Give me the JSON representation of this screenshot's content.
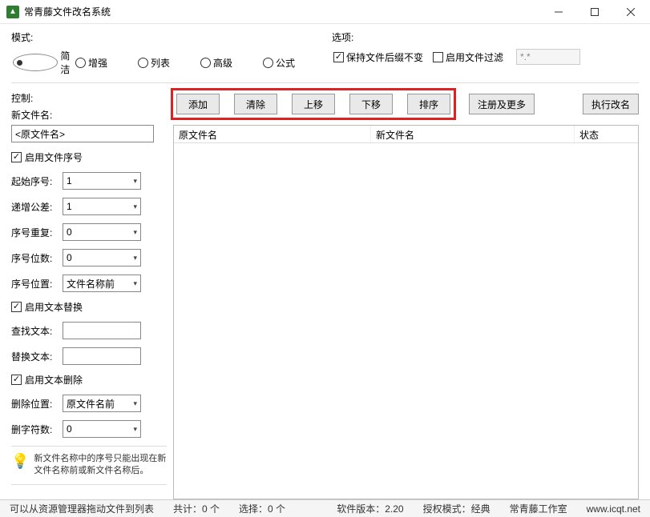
{
  "window": {
    "title": "常青藤文件改名系统",
    "icon_glyph": "▲"
  },
  "mode": {
    "label": "模式:",
    "options": [
      "简洁",
      "增强",
      "列表",
      "高级",
      "公式"
    ],
    "selected": "简洁"
  },
  "options": {
    "label": "选项:",
    "keep_ext": {
      "label": "保持文件后缀不变",
      "checked": true
    },
    "enable_filter": {
      "label": "启用文件过滤",
      "checked": false
    },
    "filter_value": "*.*"
  },
  "control": {
    "label": "控制:",
    "new_name": {
      "label": "新文件名:",
      "value": "<原文件名>"
    },
    "enable_seq": {
      "label": "启用文件序号",
      "checked": true
    },
    "start_no": {
      "label": "起始序号:",
      "value": "1"
    },
    "step": {
      "label": "递增公差:",
      "value": "1"
    },
    "repeat": {
      "label": "序号重复:",
      "value": "0"
    },
    "digits": {
      "label": "序号位数:",
      "value": "0"
    },
    "pos": {
      "label": "序号位置:",
      "value": "文件名称前"
    },
    "enable_replace": {
      "label": "启用文本替换",
      "checked": true
    },
    "find": {
      "label": "查找文本:",
      "value": ""
    },
    "replace": {
      "label": "替换文本:",
      "value": ""
    },
    "enable_delete": {
      "label": "启用文本删除",
      "checked": true
    },
    "del_pos": {
      "label": "删除位置:",
      "value": "原文件名前"
    },
    "del_count": {
      "label": "删字符数:",
      "value": "0"
    },
    "tip": "新文件名称中的序号只能出现在新文件名称前或新文件名称后。"
  },
  "buttons": {
    "add": "添加",
    "clear": "清除",
    "up": "上移",
    "down": "下移",
    "sort": "排序",
    "register": "注册及更多",
    "execute": "执行改名"
  },
  "list": {
    "col_original": "原文件名",
    "col_new": "新文件名",
    "col_status": "状态"
  },
  "status": {
    "drag_hint": "可以从资源管理器拖动文件到列表",
    "count": "共计：0 个",
    "selected": "选择：0 个",
    "version": "软件版本：2.20",
    "license": "授权模式：经典",
    "studio": "常青藤工作室",
    "url": "www.icqt.net"
  }
}
